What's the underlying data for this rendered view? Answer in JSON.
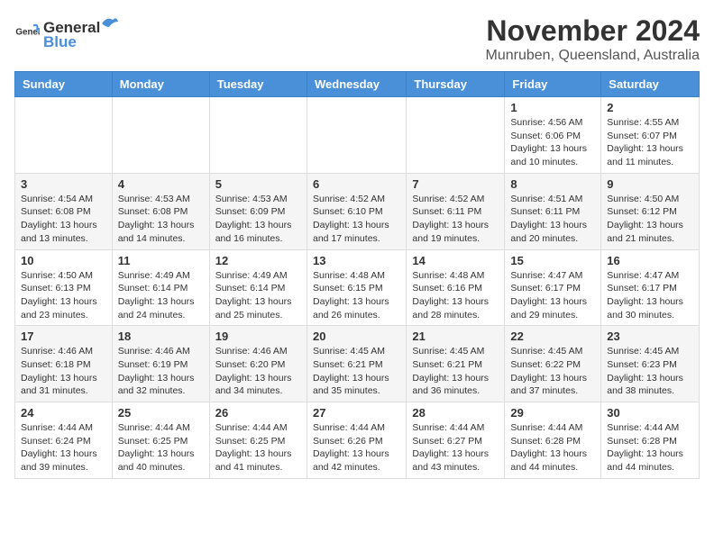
{
  "header": {
    "logo_general": "General",
    "logo_blue": "Blue",
    "month_title": "November 2024",
    "location": "Munruben, Queensland, Australia"
  },
  "weekdays": [
    "Sunday",
    "Monday",
    "Tuesday",
    "Wednesday",
    "Thursday",
    "Friday",
    "Saturday"
  ],
  "weeks": [
    [
      {
        "day": "",
        "info": ""
      },
      {
        "day": "",
        "info": ""
      },
      {
        "day": "",
        "info": ""
      },
      {
        "day": "",
        "info": ""
      },
      {
        "day": "",
        "info": ""
      },
      {
        "day": "1",
        "info": "Sunrise: 4:56 AM\nSunset: 6:06 PM\nDaylight: 13 hours and 10 minutes."
      },
      {
        "day": "2",
        "info": "Sunrise: 4:55 AM\nSunset: 6:07 PM\nDaylight: 13 hours and 11 minutes."
      }
    ],
    [
      {
        "day": "3",
        "info": "Sunrise: 4:54 AM\nSunset: 6:08 PM\nDaylight: 13 hours and 13 minutes."
      },
      {
        "day": "4",
        "info": "Sunrise: 4:53 AM\nSunset: 6:08 PM\nDaylight: 13 hours and 14 minutes."
      },
      {
        "day": "5",
        "info": "Sunrise: 4:53 AM\nSunset: 6:09 PM\nDaylight: 13 hours and 16 minutes."
      },
      {
        "day": "6",
        "info": "Sunrise: 4:52 AM\nSunset: 6:10 PM\nDaylight: 13 hours and 17 minutes."
      },
      {
        "day": "7",
        "info": "Sunrise: 4:52 AM\nSunset: 6:11 PM\nDaylight: 13 hours and 19 minutes."
      },
      {
        "day": "8",
        "info": "Sunrise: 4:51 AM\nSunset: 6:11 PM\nDaylight: 13 hours and 20 minutes."
      },
      {
        "day": "9",
        "info": "Sunrise: 4:50 AM\nSunset: 6:12 PM\nDaylight: 13 hours and 21 minutes."
      }
    ],
    [
      {
        "day": "10",
        "info": "Sunrise: 4:50 AM\nSunset: 6:13 PM\nDaylight: 13 hours and 23 minutes."
      },
      {
        "day": "11",
        "info": "Sunrise: 4:49 AM\nSunset: 6:14 PM\nDaylight: 13 hours and 24 minutes."
      },
      {
        "day": "12",
        "info": "Sunrise: 4:49 AM\nSunset: 6:14 PM\nDaylight: 13 hours and 25 minutes."
      },
      {
        "day": "13",
        "info": "Sunrise: 4:48 AM\nSunset: 6:15 PM\nDaylight: 13 hours and 26 minutes."
      },
      {
        "day": "14",
        "info": "Sunrise: 4:48 AM\nSunset: 6:16 PM\nDaylight: 13 hours and 28 minutes."
      },
      {
        "day": "15",
        "info": "Sunrise: 4:47 AM\nSunset: 6:17 PM\nDaylight: 13 hours and 29 minutes."
      },
      {
        "day": "16",
        "info": "Sunrise: 4:47 AM\nSunset: 6:17 PM\nDaylight: 13 hours and 30 minutes."
      }
    ],
    [
      {
        "day": "17",
        "info": "Sunrise: 4:46 AM\nSunset: 6:18 PM\nDaylight: 13 hours and 31 minutes."
      },
      {
        "day": "18",
        "info": "Sunrise: 4:46 AM\nSunset: 6:19 PM\nDaylight: 13 hours and 32 minutes."
      },
      {
        "day": "19",
        "info": "Sunrise: 4:46 AM\nSunset: 6:20 PM\nDaylight: 13 hours and 34 minutes."
      },
      {
        "day": "20",
        "info": "Sunrise: 4:45 AM\nSunset: 6:21 PM\nDaylight: 13 hours and 35 minutes."
      },
      {
        "day": "21",
        "info": "Sunrise: 4:45 AM\nSunset: 6:21 PM\nDaylight: 13 hours and 36 minutes."
      },
      {
        "day": "22",
        "info": "Sunrise: 4:45 AM\nSunset: 6:22 PM\nDaylight: 13 hours and 37 minutes."
      },
      {
        "day": "23",
        "info": "Sunrise: 4:45 AM\nSunset: 6:23 PM\nDaylight: 13 hours and 38 minutes."
      }
    ],
    [
      {
        "day": "24",
        "info": "Sunrise: 4:44 AM\nSunset: 6:24 PM\nDaylight: 13 hours and 39 minutes."
      },
      {
        "day": "25",
        "info": "Sunrise: 4:44 AM\nSunset: 6:25 PM\nDaylight: 13 hours and 40 minutes."
      },
      {
        "day": "26",
        "info": "Sunrise: 4:44 AM\nSunset: 6:25 PM\nDaylight: 13 hours and 41 minutes."
      },
      {
        "day": "27",
        "info": "Sunrise: 4:44 AM\nSunset: 6:26 PM\nDaylight: 13 hours and 42 minutes."
      },
      {
        "day": "28",
        "info": "Sunrise: 4:44 AM\nSunset: 6:27 PM\nDaylight: 13 hours and 43 minutes."
      },
      {
        "day": "29",
        "info": "Sunrise: 4:44 AM\nSunset: 6:28 PM\nDaylight: 13 hours and 44 minutes."
      },
      {
        "day": "30",
        "info": "Sunrise: 4:44 AM\nSunset: 6:28 PM\nDaylight: 13 hours and 44 minutes."
      }
    ]
  ]
}
